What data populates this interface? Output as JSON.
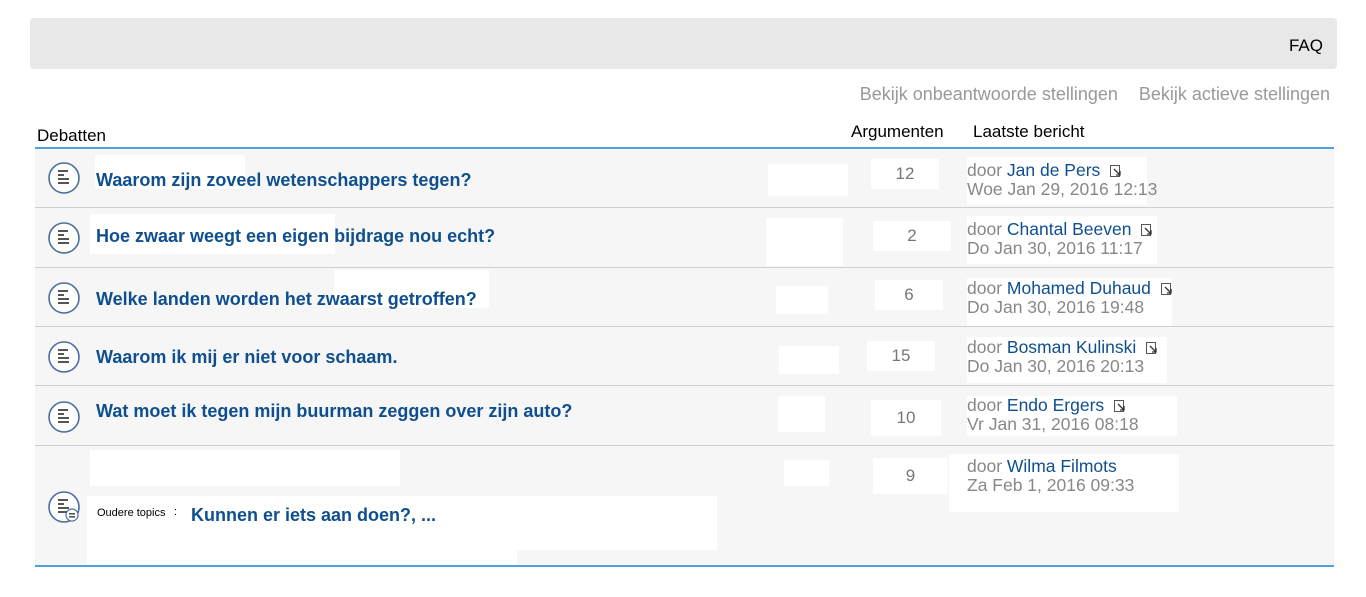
{
  "navbar": {
    "faq": "FAQ"
  },
  "links": {
    "unanswered": "Bekijk onbeantwoorde stellingen",
    "active": "Bekijk actieve stellingen"
  },
  "table": {
    "col_topics": "Debatten",
    "col_replies": "Argumenten",
    "col_last": "Laatste bericht",
    "rows": [
      {
        "title": "Waarom zijn zoveel wetenschappers tegen?",
        "count": "12",
        "by": "door",
        "user": "Jan de Pers",
        "date": "Woe Jan 29, 2016 12:13"
      },
      {
        "title": "Hoe zwaar weegt een eigen bijdrage nou echt?",
        "count": "2",
        "by": "door",
        "user": "Chantal Beeven",
        "date": "Do Jan 30, 2016 11:17"
      },
      {
        "title": "Welke landen worden het zwaarst getroffen?",
        "count": "6",
        "by": "door",
        "user": "Mohamed Duhaud",
        "date": "Do Jan 30, 2016 19:48"
      },
      {
        "title": "Waarom ik mij er niet voor schaam.",
        "count": "15",
        "by": "door",
        "user": "Bosman Kulinski",
        "date": "Do Jan 30, 2016 20:13"
      },
      {
        "title": "Wat moet ik tegen mijn buurman zeggen over zijn auto?",
        "count": "10",
        "by": "door",
        "user": "Endo Ergers",
        "date": "Vr Jan 31, 2016 08:18"
      }
    ],
    "older": {
      "label": "Oudere topics",
      "sep": ":",
      "title": "Kunnen er iets aan doen?, ...",
      "count": "9",
      "by": "door",
      "user": "Wilma Filmots",
      "date": "Za Feb 1, 2016 09:33"
    }
  },
  "colors": {
    "link": "#0f4f8f",
    "accent": "#4da3dc"
  },
  "icons": {
    "topic": "topic-read-icon",
    "goto": "goto-last-post-icon"
  }
}
